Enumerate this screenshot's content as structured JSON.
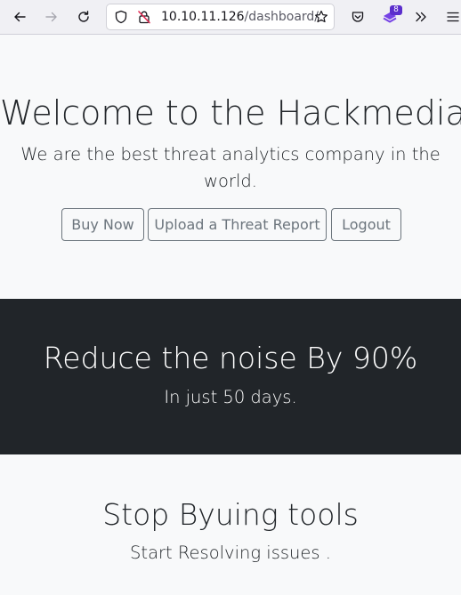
{
  "browser": {
    "url_host": "10.10.11.126",
    "url_path": "/dashboard/",
    "extension_badge": "8",
    "icons": [
      "back-arrow-icon",
      "forward-arrow-icon",
      "reload-icon",
      "shield-icon",
      "insecure-lock-icon",
      "bookmark-star-icon",
      "pocket-icon",
      "extension-icon",
      "overflow-chevrons-icon",
      "hamburger-menu-icon"
    ]
  },
  "hero": {
    "title": "Welcome to the Hackmedia",
    "subtitle": "We are the best threat analytics company in the world.",
    "buttons": [
      {
        "label": "Buy Now"
      },
      {
        "label": "Upload a Threat Report"
      },
      {
        "label": "Logout"
      }
    ],
    "button_color": "#6c757d"
  },
  "banner": {
    "title": "Reduce the noise By 90%",
    "subtitle": "In just 50 days.",
    "background": "#212529"
  },
  "section3": {
    "title": "Stop Byuing tools",
    "subtitle": "Start Resolving issues ."
  }
}
